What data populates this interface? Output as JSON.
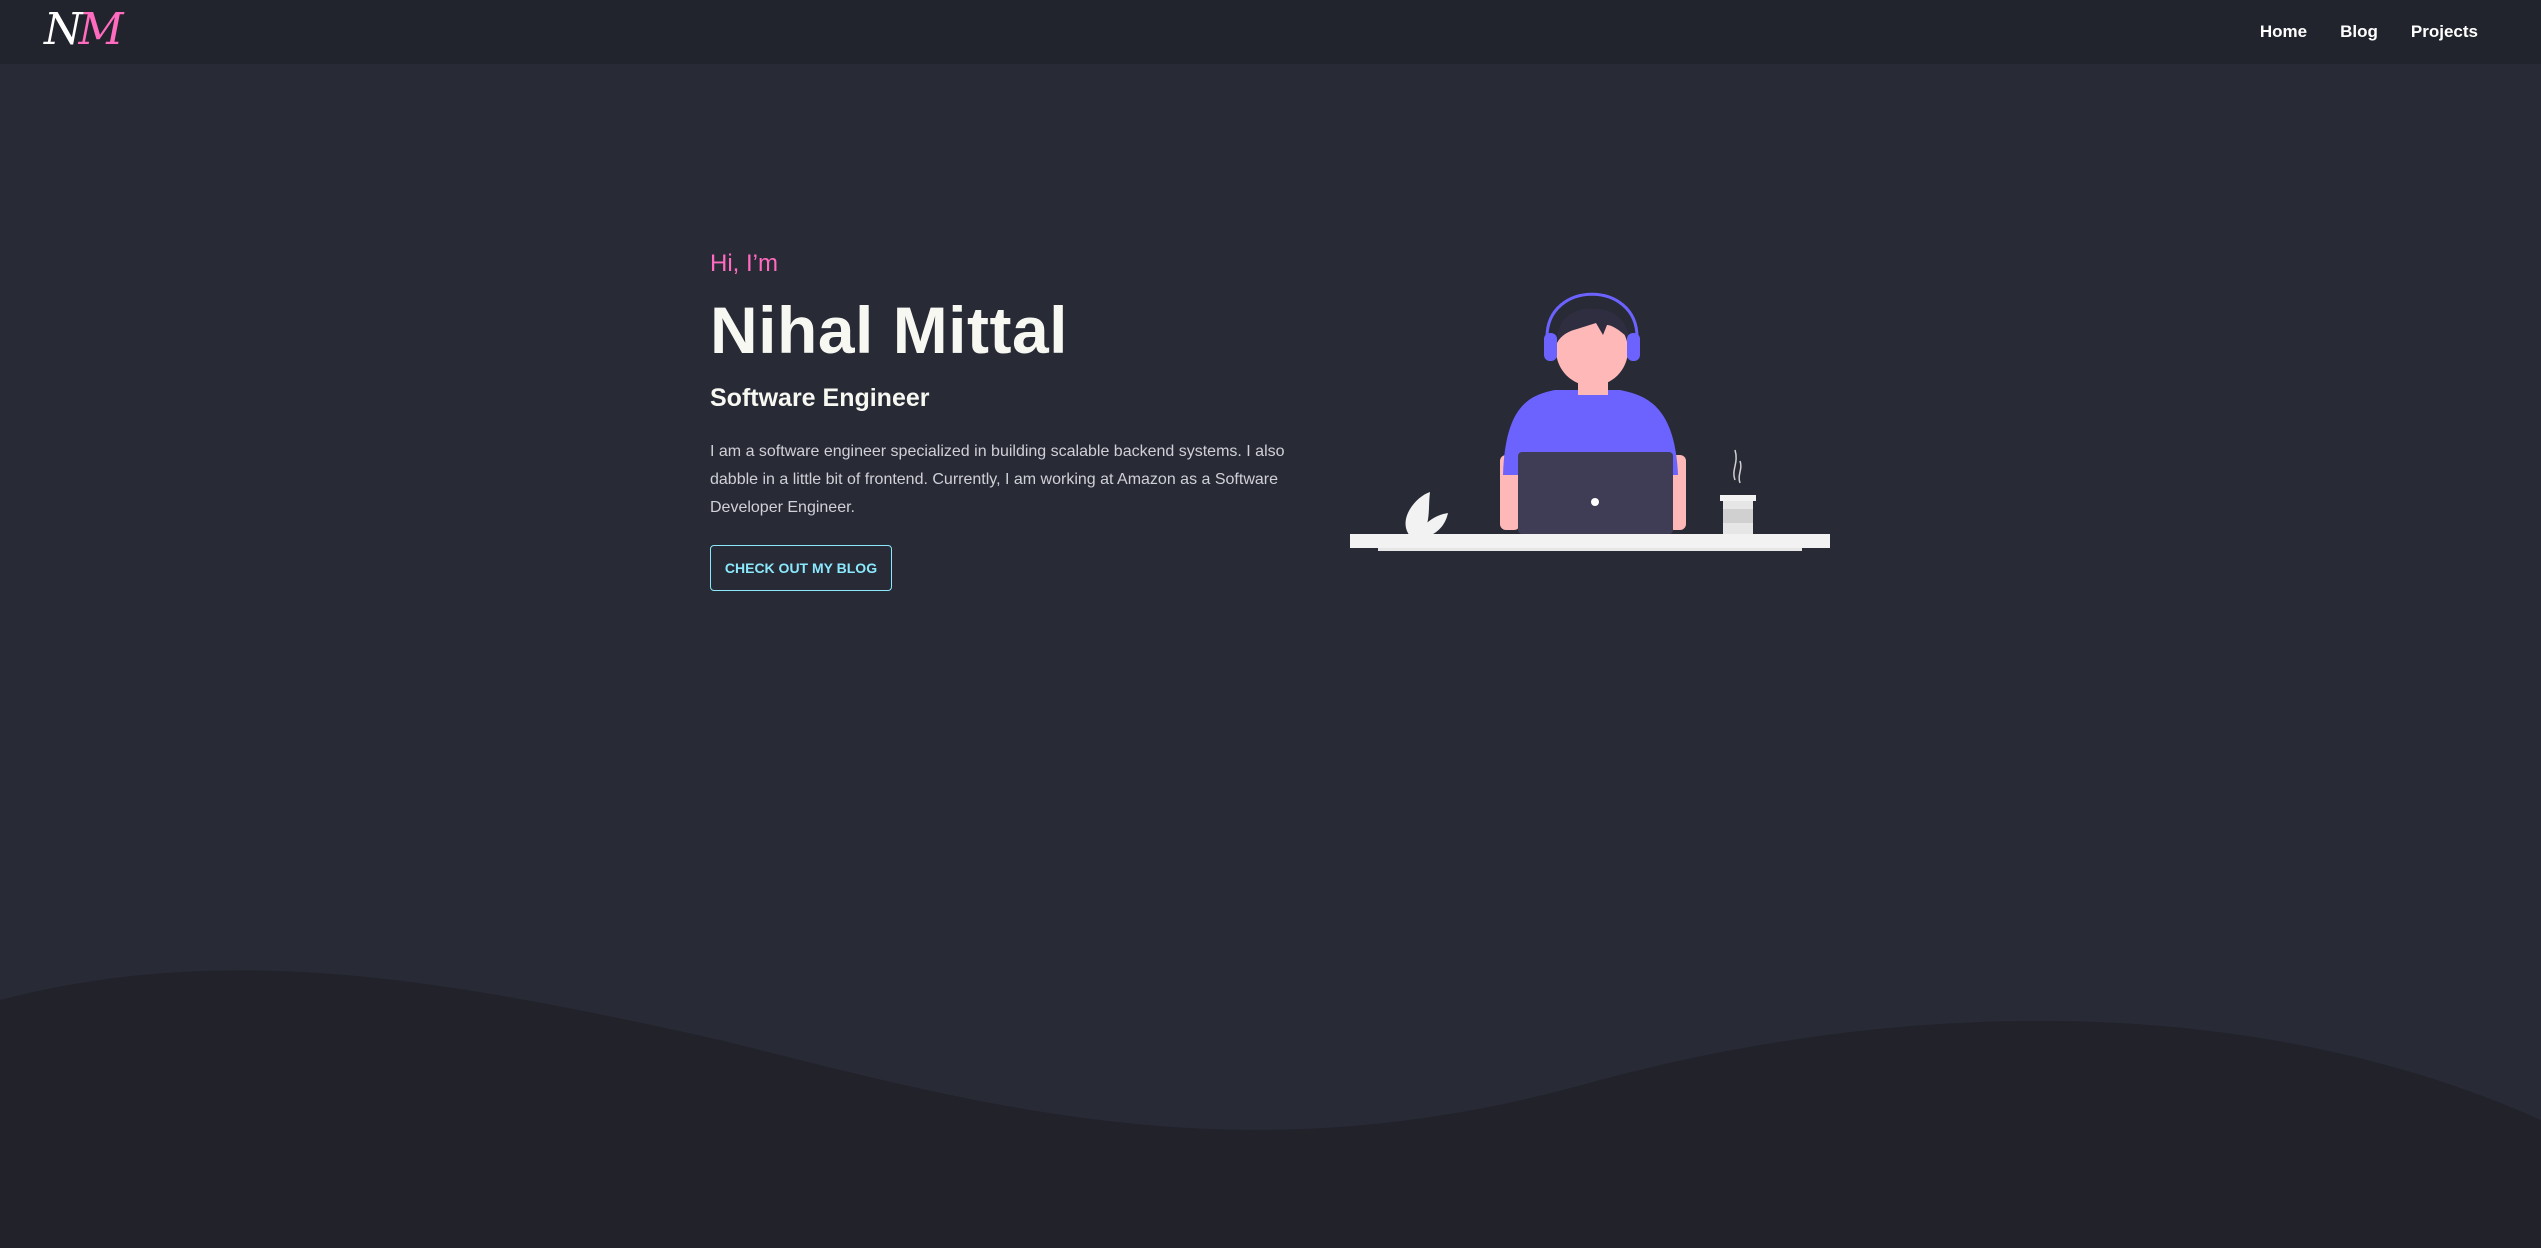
{
  "navbar": {
    "logo": {
      "first": "N",
      "second": "M"
    },
    "links": [
      {
        "label": "Home"
      },
      {
        "label": "Blog"
      },
      {
        "label": "Projects"
      }
    ]
  },
  "hero": {
    "greeting": "Hi, I’m",
    "name": "Nihal Mittal",
    "role": "Software Engineer",
    "bio": "I am a software engineer specialized in building scalable backend systems. I also dabble in a little bit of frontend. Currently, I am working at Amazon as a Software Developer Engineer.",
    "cta_label": "CHECK OUT MY BLOG"
  },
  "illustration": {
    "icon": "developer-at-laptop-illustration"
  },
  "colors": {
    "background": "#282a36",
    "navbar": "#22242d",
    "accent_pink": "#ff6bbf",
    "accent_cyan": "#8be9fd",
    "illustration_purple": "#6c63ff"
  }
}
